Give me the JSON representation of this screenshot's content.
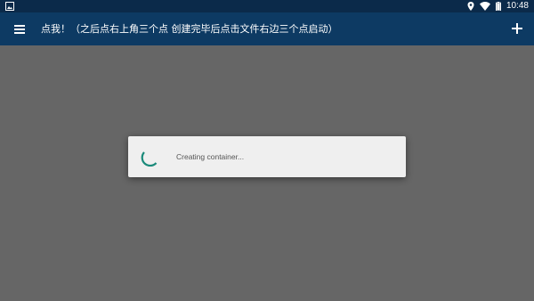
{
  "status_bar": {
    "time": "10:48",
    "icons": [
      "image-notification-icon",
      "location-icon",
      "wifi-icon",
      "battery-icon"
    ],
    "background": "#0b2a4a"
  },
  "toolbar": {
    "title": "点我！（之后点右上角三个点 创建完毕后点击文件右边三个点启动）",
    "menu_icon": "menu-icon",
    "add_icon": "add-icon",
    "background": "#0d3a63"
  },
  "content": {
    "background": "#666666"
  },
  "dialog": {
    "message": "Creating container...",
    "spinner_icon": "loading-spinner-icon",
    "spinner_color": "#1a8a7a",
    "background": "#efefef"
  }
}
